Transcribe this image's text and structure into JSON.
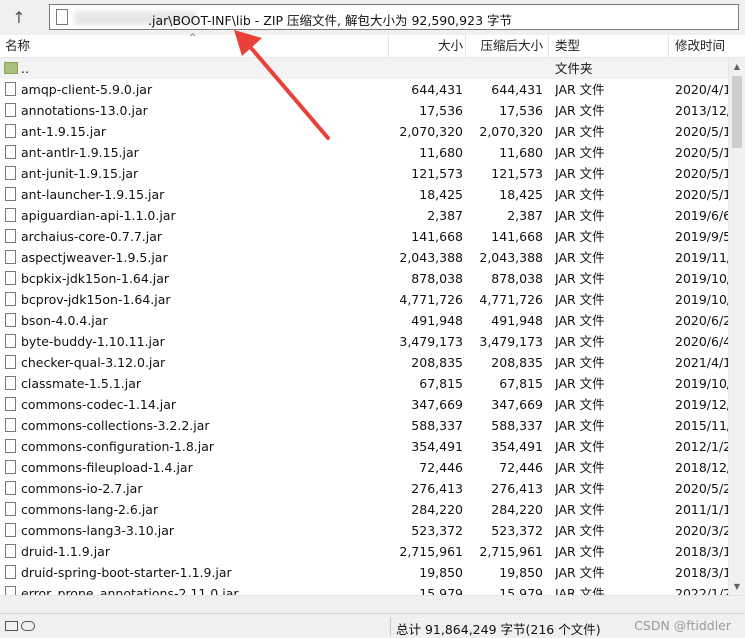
{
  "address_bar": {
    "path_text": ".jar\\BOOT-INF\\lib - ZIP 压缩文件, 解包大小为 92,590,923 字节"
  },
  "columns": {
    "name": "名称",
    "size": "大小",
    "packed": "压缩后大小",
    "type": "类型",
    "modified": "修改时间"
  },
  "parent_row": {
    "name": "..",
    "type": "文件夹"
  },
  "files": [
    {
      "name": "amqp-client-5.9.0.jar",
      "size": "644,431",
      "packed": "644,431",
      "type": "JAR 文件",
      "modified": "2020/4/1"
    },
    {
      "name": "annotations-13.0.jar",
      "size": "17,536",
      "packed": "17,536",
      "type": "JAR 文件",
      "modified": "2013/12/"
    },
    {
      "name": "ant-1.9.15.jar",
      "size": "2,070,320",
      "packed": "2,070,320",
      "type": "JAR 文件",
      "modified": "2020/5/1"
    },
    {
      "name": "ant-antlr-1.9.15.jar",
      "size": "11,680",
      "packed": "11,680",
      "type": "JAR 文件",
      "modified": "2020/5/1"
    },
    {
      "name": "ant-junit-1.9.15.jar",
      "size": "121,573",
      "packed": "121,573",
      "type": "JAR 文件",
      "modified": "2020/5/1"
    },
    {
      "name": "ant-launcher-1.9.15.jar",
      "size": "18,425",
      "packed": "18,425",
      "type": "JAR 文件",
      "modified": "2020/5/1"
    },
    {
      "name": "apiguardian-api-1.1.0.jar",
      "size": "2,387",
      "packed": "2,387",
      "type": "JAR 文件",
      "modified": "2019/6/6"
    },
    {
      "name": "archaius-core-0.7.7.jar",
      "size": "141,668",
      "packed": "141,668",
      "type": "JAR 文件",
      "modified": "2019/9/5"
    },
    {
      "name": "aspectjweaver-1.9.5.jar",
      "size": "2,043,388",
      "packed": "2,043,388",
      "type": "JAR 文件",
      "modified": "2019/11/"
    },
    {
      "name": "bcpkix-jdk15on-1.64.jar",
      "size": "878,038",
      "packed": "878,038",
      "type": "JAR 文件",
      "modified": "2019/10/"
    },
    {
      "name": "bcprov-jdk15on-1.64.jar",
      "size": "4,771,726",
      "packed": "4,771,726",
      "type": "JAR 文件",
      "modified": "2019/10/"
    },
    {
      "name": "bson-4.0.4.jar",
      "size": "491,948",
      "packed": "491,948",
      "type": "JAR 文件",
      "modified": "2020/6/2"
    },
    {
      "name": "byte-buddy-1.10.11.jar",
      "size": "3,479,173",
      "packed": "3,479,173",
      "type": "JAR 文件",
      "modified": "2020/6/4"
    },
    {
      "name": "checker-qual-3.12.0.jar",
      "size": "208,835",
      "packed": "208,835",
      "type": "JAR 文件",
      "modified": "2021/4/1"
    },
    {
      "name": "classmate-1.5.1.jar",
      "size": "67,815",
      "packed": "67,815",
      "type": "JAR 文件",
      "modified": "2019/10/"
    },
    {
      "name": "commons-codec-1.14.jar",
      "size": "347,669",
      "packed": "347,669",
      "type": "JAR 文件",
      "modified": "2019/12/"
    },
    {
      "name": "commons-collections-3.2.2.jar",
      "size": "588,337",
      "packed": "588,337",
      "type": "JAR 文件",
      "modified": "2015/11/"
    },
    {
      "name": "commons-configuration-1.8.jar",
      "size": "354,491",
      "packed": "354,491",
      "type": "JAR 文件",
      "modified": "2012/1/2"
    },
    {
      "name": "commons-fileupload-1.4.jar",
      "size": "72,446",
      "packed": "72,446",
      "type": "JAR 文件",
      "modified": "2018/12/"
    },
    {
      "name": "commons-io-2.7.jar",
      "size": "276,413",
      "packed": "276,413",
      "type": "JAR 文件",
      "modified": "2020/5/2"
    },
    {
      "name": "commons-lang-2.6.jar",
      "size": "284,220",
      "packed": "284,220",
      "type": "JAR 文件",
      "modified": "2011/1/1"
    },
    {
      "name": "commons-lang3-3.10.jar",
      "size": "523,372",
      "packed": "523,372",
      "type": "JAR 文件",
      "modified": "2020/3/2"
    },
    {
      "name": "druid-1.1.9.jar",
      "size": "2,715,961",
      "packed": "2,715,961",
      "type": "JAR 文件",
      "modified": "2018/3/1"
    },
    {
      "name": "druid-spring-boot-starter-1.1.9.jar",
      "size": "19,850",
      "packed": "19,850",
      "type": "JAR 文件",
      "modified": "2018/3/1"
    },
    {
      "name": "error_prone_annotations-2.11.0.jar",
      "size": "15,979",
      "packed": "15,979",
      "type": "JAR 文件",
      "modified": "2022/1/2"
    }
  ],
  "status_bar": {
    "summary": "总计 91,864,249 字节(216 个文件)",
    "watermark": "CSDN @ftiddler"
  },
  "annotation_color": "#e8413a"
}
